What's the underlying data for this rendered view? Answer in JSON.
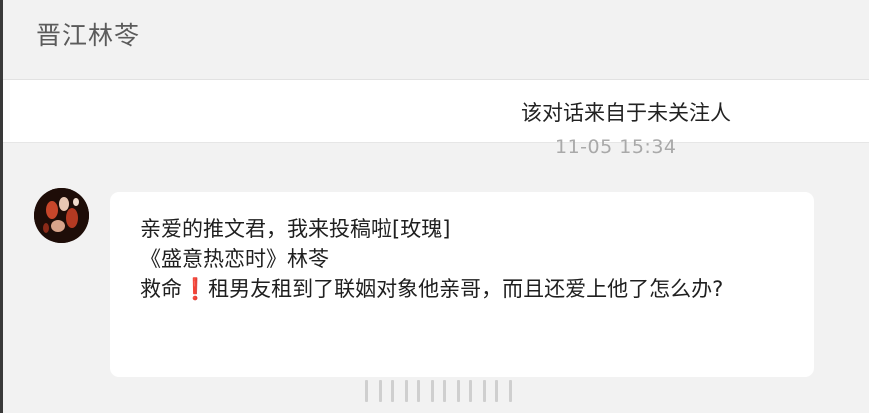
{
  "header": {
    "title": "晋江林苓"
  },
  "notice": {
    "text": "该对话来自于未关注人"
  },
  "message": {
    "timestamp": "11-05 15:34",
    "line1": "亲爱的推文君，我来投稿啦[玫瑰]",
    "line2": "《盛意热恋时》林苓",
    "line3_before": "救命",
    "line3_emoji": "❗",
    "line3_after": "租男友租到了联姻对象他亲哥，而且还爱上他了怎么办?"
  },
  "icons": {
    "avatar": "sender-avatar",
    "exclamation": "red-exclamation-emoji"
  },
  "colors": {
    "background": "#f2f2f2",
    "bubble": "#ffffff",
    "text": "#1f1f1f",
    "header_text": "#5b5b5b",
    "timestamp": "#a9a9a9",
    "exclamation": "#e02424"
  }
}
